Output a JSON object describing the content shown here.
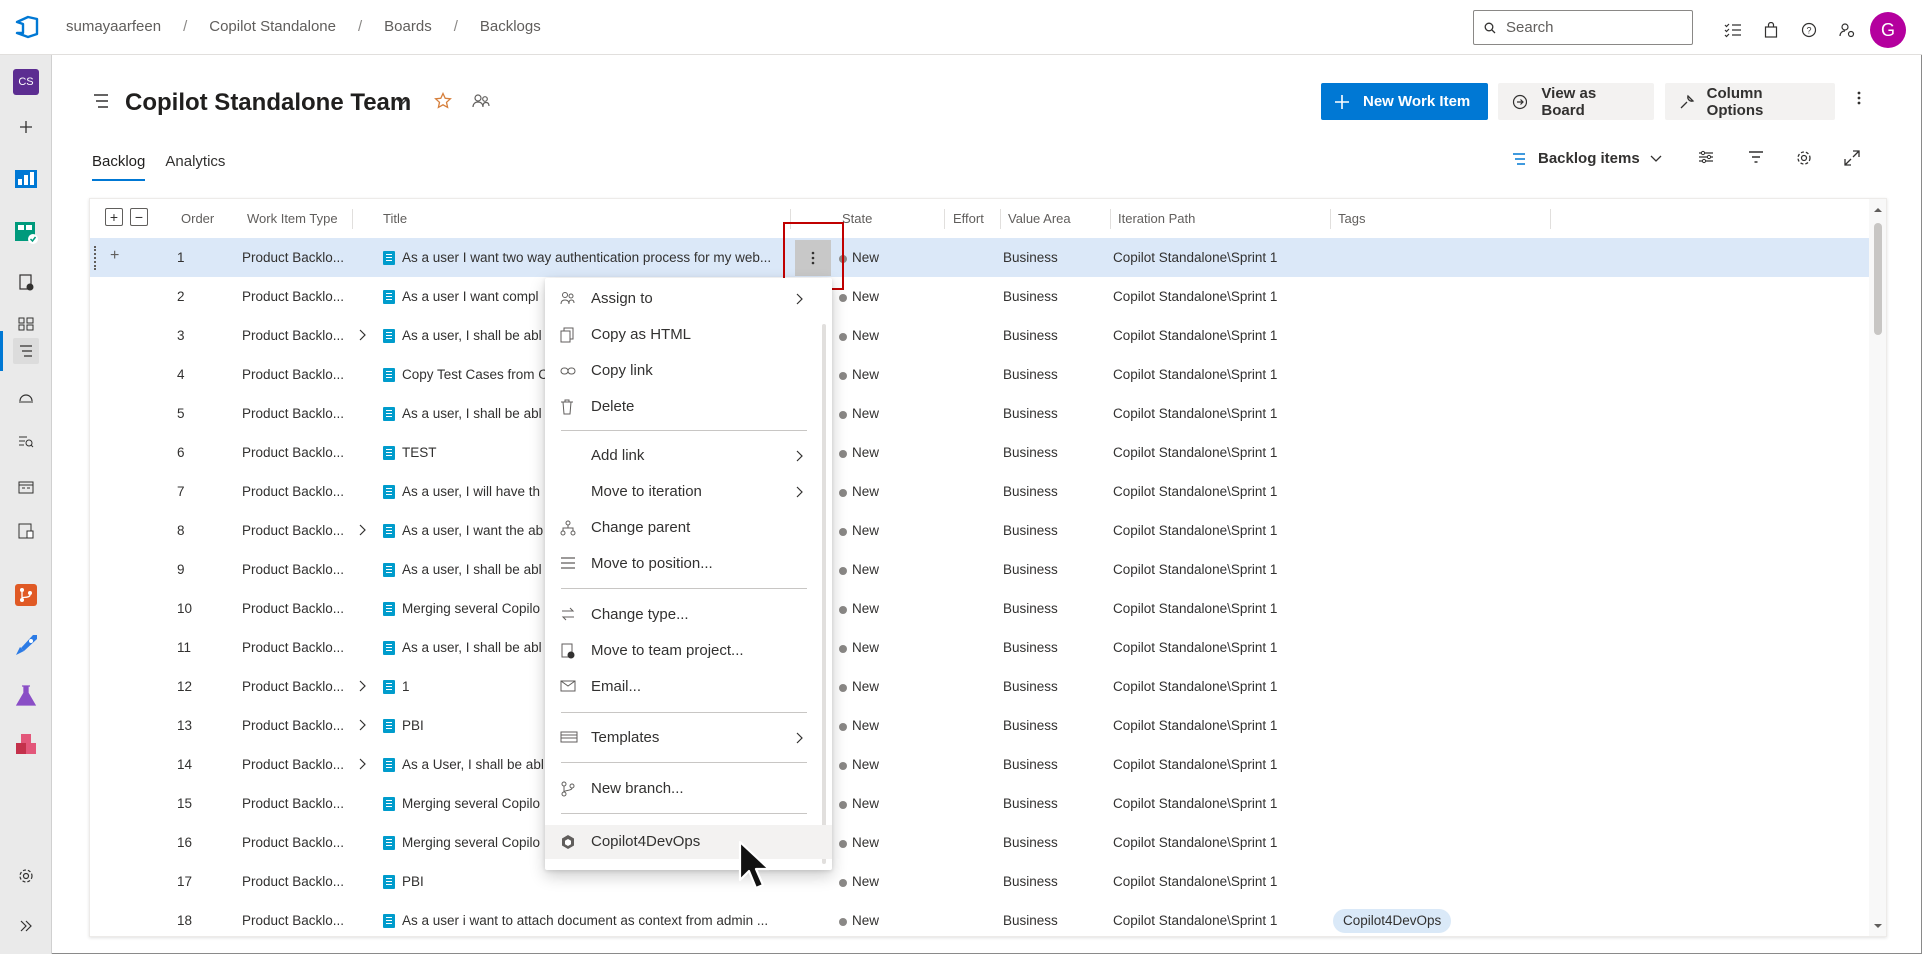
{
  "breadcrumb": [
    "sumayaarfeen",
    "Copilot Standalone",
    "Boards",
    "Backlogs"
  ],
  "search": {
    "placeholder": "Search"
  },
  "user": {
    "initial": "G"
  },
  "project_badge": "CS",
  "team": {
    "title": "Copilot Standalone Team"
  },
  "actions": {
    "new_work_item": "New Work Item",
    "view_as_board": "View as Board",
    "column_options": "Column Options"
  },
  "tabs": [
    "Backlog",
    "Analytics"
  ],
  "backlog_level": "Backlog items",
  "columns": [
    "Order",
    "Work Item Type",
    "Title",
    "State",
    "Effort",
    "Value Area",
    "Iteration Path",
    "Tags"
  ],
  "rows": [
    {
      "order": "1",
      "type": "Product Backlo...",
      "title": "As a user I want two way authentication process for my web...",
      "state": "New",
      "area": "Business",
      "iteration": "Copilot Standalone\\Sprint 1",
      "tag": "",
      "expand": false
    },
    {
      "order": "2",
      "type": "Product Backlo...",
      "title": "As a user I want compl",
      "state": "New",
      "area": "Business",
      "iteration": "Copilot Standalone\\Sprint 1",
      "tag": "",
      "expand": false
    },
    {
      "order": "3",
      "type": "Product Backlo...",
      "title": "As a user, I shall be abl",
      "state": "New",
      "area": "Business",
      "iteration": "Copilot Standalone\\Sprint 1",
      "tag": "",
      "expand": true
    },
    {
      "order": "4",
      "type": "Product Backlo...",
      "title": "Copy Test Cases from C",
      "state": "New",
      "area": "Business",
      "iteration": "Copilot Standalone\\Sprint 1",
      "tag": "",
      "expand": false
    },
    {
      "order": "5",
      "type": "Product Backlo...",
      "title": "As a user, I shall be abl",
      "state": "New",
      "area": "Business",
      "iteration": "Copilot Standalone\\Sprint 1",
      "tag": "",
      "expand": false
    },
    {
      "order": "6",
      "type": "Product Backlo...",
      "title": "TEST",
      "state": "New",
      "area": "Business",
      "iteration": "Copilot Standalone\\Sprint 1",
      "tag": "",
      "expand": false
    },
    {
      "order": "7",
      "type": "Product Backlo...",
      "title": "As a user, I will have th",
      "state": "New",
      "area": "Business",
      "iteration": "Copilot Standalone\\Sprint 1",
      "tag": "",
      "expand": false
    },
    {
      "order": "8",
      "type": "Product Backlo...",
      "title": "As a user, I want the ab",
      "state": "New",
      "area": "Business",
      "iteration": "Copilot Standalone\\Sprint 1",
      "tag": "",
      "expand": true
    },
    {
      "order": "9",
      "type": "Product Backlo...",
      "title": "As a user, I shall be abl",
      "state": "New",
      "area": "Business",
      "iteration": "Copilot Standalone\\Sprint 1",
      "tag": "",
      "expand": false
    },
    {
      "order": "10",
      "type": "Product Backlo...",
      "title": "Merging several Copilo",
      "state": "New",
      "area": "Business",
      "iteration": "Copilot Standalone\\Sprint 1",
      "tag": "",
      "expand": false
    },
    {
      "order": "11",
      "type": "Product Backlo...",
      "title": "As a user, I shall be abl",
      "state": "New",
      "area": "Business",
      "iteration": "Copilot Standalone\\Sprint 1",
      "tag": "",
      "expand": false
    },
    {
      "order": "12",
      "type": "Product Backlo...",
      "title": "1",
      "state": "New",
      "area": "Business",
      "iteration": "Copilot Standalone\\Sprint 1",
      "tag": "",
      "expand": true
    },
    {
      "order": "13",
      "type": "Product Backlo...",
      "title": "PBI",
      "state": "New",
      "area": "Business",
      "iteration": "Copilot Standalone\\Sprint 1",
      "tag": "",
      "expand": true
    },
    {
      "order": "14",
      "type": "Product Backlo...",
      "title": "As a User, I shall be abl",
      "state": "New",
      "area": "Business",
      "iteration": "Copilot Standalone\\Sprint 1",
      "tag": "",
      "expand": true
    },
    {
      "order": "15",
      "type": "Product Backlo...",
      "title": "Merging several Copilo",
      "state": "New",
      "area": "Business",
      "iteration": "Copilot Standalone\\Sprint 1",
      "tag": "",
      "expand": false
    },
    {
      "order": "16",
      "type": "Product Backlo...",
      "title": "Merging several Copilo",
      "state": "New",
      "area": "Business",
      "iteration": "Copilot Standalone\\Sprint 1",
      "tag": "",
      "expand": false
    },
    {
      "order": "17",
      "type": "Product Backlo...",
      "title": "PBI",
      "state": "New",
      "area": "Business",
      "iteration": "Copilot Standalone\\Sprint 1",
      "tag": "",
      "expand": false
    },
    {
      "order": "18",
      "type": "Product Backlo...",
      "title": "As a user i want to attach document as context from admin ...",
      "state": "New",
      "area": "Business",
      "iteration": "Copilot Standalone\\Sprint 1",
      "tag": "Copilot4DevOps",
      "expand": false
    }
  ],
  "context_menu": [
    {
      "label": "Assign to",
      "icon": "people-icon",
      "submenu": true
    },
    {
      "label": "Copy as HTML",
      "icon": "copy-icon",
      "submenu": false
    },
    {
      "label": "Copy link",
      "icon": "link-icon",
      "submenu": false
    },
    {
      "label": "Delete",
      "icon": "trash-icon",
      "submenu": false
    },
    {
      "label": "Add link",
      "icon": "",
      "submenu": true
    },
    {
      "label": "Move to iteration",
      "icon": "",
      "submenu": true
    },
    {
      "label": "Change parent",
      "icon": "hierarchy-icon",
      "submenu": false
    },
    {
      "label": "Move to position...",
      "icon": "lines-icon",
      "submenu": false
    },
    {
      "label": "Change type...",
      "icon": "swap-icon",
      "submenu": false
    },
    {
      "label": "Move to team project...",
      "icon": "project-move-icon",
      "submenu": false
    },
    {
      "label": "Email...",
      "icon": "mail-icon",
      "submenu": false
    },
    {
      "label": "Templates",
      "icon": "template-icon",
      "submenu": true
    },
    {
      "label": "New branch...",
      "icon": "branch-icon",
      "submenu": false
    },
    {
      "label": "Copilot4DevOps",
      "icon": "hexagon-icon",
      "submenu": false
    }
  ],
  "colors": {
    "accent": "#0078d4",
    "selected_row": "#dbe8f8",
    "avatar": "#b4009e",
    "highlight_box": "#c00000",
    "work_item": "#009ccc"
  }
}
